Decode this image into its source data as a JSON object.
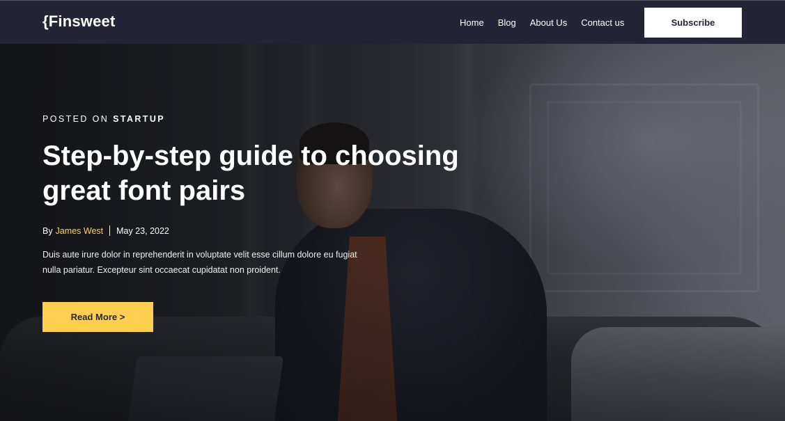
{
  "header": {
    "logo": "{Finsweet",
    "nav": [
      "Home",
      "Blog",
      "About Us",
      "Contact us"
    ],
    "subscribe_label": "Subscribe"
  },
  "hero": {
    "posted_on_prefix": "POSTED ON",
    "category": "STARTUP",
    "title": "Step-by-step guide to choosing great font pairs",
    "by_prefix": "By",
    "author": "James West",
    "date": "May 23, 2022",
    "excerpt": "Duis aute irure dolor in reprehenderit in voluptate velit esse cillum dolore eu fugiat nulla pariatur. Excepteur sint occaecat cupidatat non proident.",
    "read_more_label": "Read More >"
  },
  "colors": {
    "navbar_bg": "#232536",
    "accent_yellow": "#ffd050",
    "text_white": "#ffffff"
  }
}
